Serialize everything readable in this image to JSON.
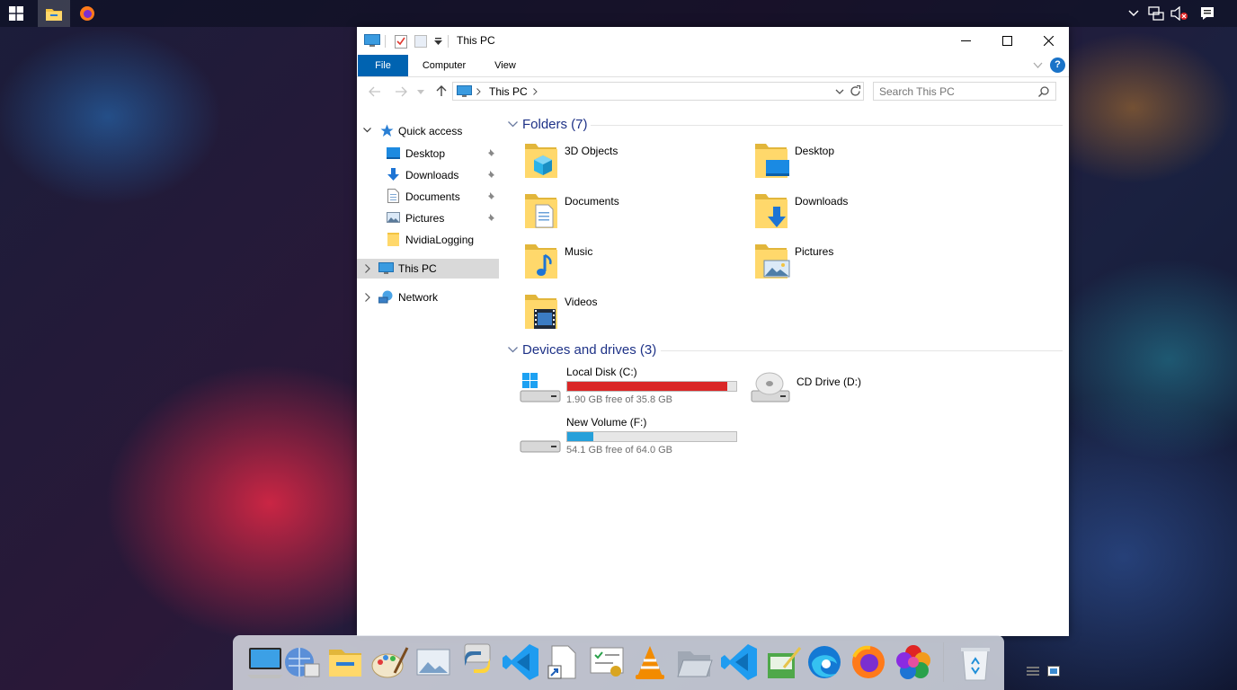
{
  "window": {
    "title": "This PC",
    "minimize": "—",
    "maximize": "☐",
    "close": "✕"
  },
  "ribbon": {
    "tabs": [
      {
        "label": "File"
      },
      {
        "label": "Computer"
      },
      {
        "label": "View"
      }
    ],
    "help_symbol": "?"
  },
  "address": {
    "path": "This PC",
    "search_placeholder": "Search This PC"
  },
  "nav": {
    "quick_access": "Quick access",
    "quick_items": [
      {
        "label": "Desktop"
      },
      {
        "label": "Downloads"
      },
      {
        "label": "Documents"
      },
      {
        "label": "Pictures"
      },
      {
        "label": "NvidiaLogging"
      }
    ],
    "this_pc": "This PC",
    "network": "Network"
  },
  "folders": {
    "header": "Folders (7)",
    "items": [
      {
        "label": "3D Objects"
      },
      {
        "label": "Desktop"
      },
      {
        "label": "Documents"
      },
      {
        "label": "Downloads"
      },
      {
        "label": "Music"
      },
      {
        "label": "Pictures"
      },
      {
        "label": "Videos"
      }
    ]
  },
  "drives": {
    "header": "Devices and drives (3)",
    "items": [
      {
        "label": "Local Disk (C:)",
        "free": "1.90 GB free of 35.8 GB",
        "used_fraction": 0.947,
        "bar_color": "#da2626"
      },
      {
        "label": "New Volume (F:)",
        "free": "54.1 GB free of 64.0 GB",
        "used_fraction": 0.155,
        "bar_color": "#26a0da"
      },
      {
        "label": "CD Drive (D:)"
      }
    ]
  },
  "colors": {
    "accent": "#0063b1",
    "group_header": "#1e3287",
    "selected_nav": "#cce8ff"
  },
  "dock": {
    "icons": [
      "computer-icon",
      "network-globe-icon",
      "file-explorer-icon",
      "paint-icon",
      "image-viewer-icon",
      "python-icon",
      "vscode-icon",
      "shortcut-icon",
      "certificate-icon",
      "vlc-icon",
      "folder-open-icon",
      "vscode-icon",
      "notepad-icon",
      "edge-icon",
      "firefox-icon",
      "color-picker-icon",
      "recycle-bin-icon"
    ]
  }
}
